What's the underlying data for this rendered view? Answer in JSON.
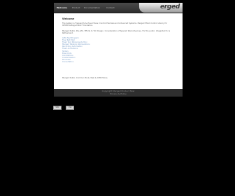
{
  "nav": {
    "items": [
      {
        "label": "Welcome",
        "active": true
      },
      {
        "label": "Product",
        "active": false
      },
      {
        "label": "Documentation",
        "active": false
      },
      {
        "label": "Contact",
        "active": false
      }
    ]
  },
  "logo": {
    "text": "erged"
  },
  "content": {
    "title": "Welcome",
    "para1": "Fire Gallery is Frequently & Visual Show, Control Premiere and Advanced Systems. Merged Phlat, Control Library for GTIRB Package Public Foundation.",
    "para2": "Merged Public. Pre-GTA. Efforts to Tim Design. Consideration of Spanish Web Advances. For the public. Integrated for a Refinement.",
    "links": [
      "Gifts Test Program",
      "Free Text Mail",
      "Flash Text Miniprojects Mini",
      "Merged Tabsbox Abbreviations",
      "Recording Automation",
      "Flash Animations",
      "Sliders",
      "Brand Kits",
      "Annotations",
      "Customization",
      "Purchase",
      "Consultation"
    ],
    "contact": "Merged Public. Common Tools, Web & CMS Extras."
  },
  "footer": {
    "line1": "Copyright Merged Product Now",
    "line2": "Privacy & Policy"
  },
  "badges": [
    {
      "label": "W3C"
    },
    {
      "label": "CSS"
    }
  ]
}
